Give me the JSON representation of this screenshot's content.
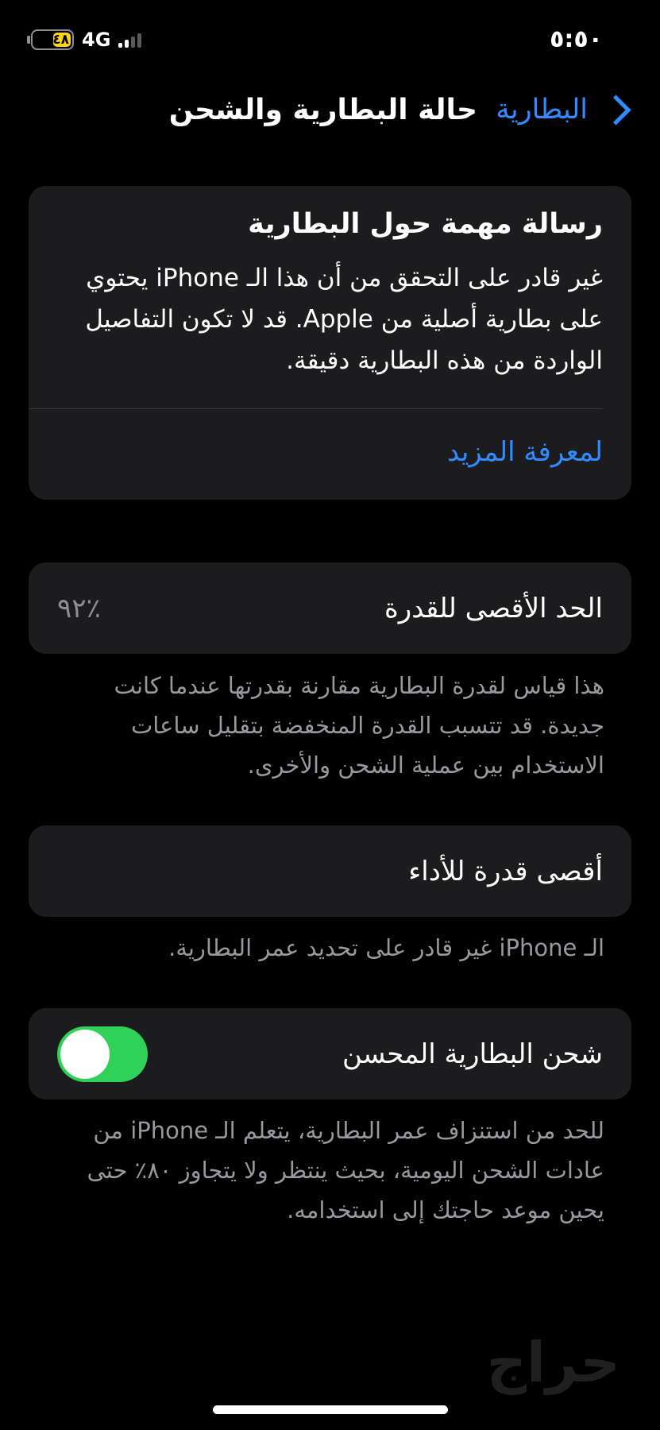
{
  "status_bar": {
    "time": "٥:٥٠",
    "battery_level": "٤٨",
    "battery_fraction": 0.48,
    "network": "4G",
    "signal_bars_active": 2,
    "signal_bars_total": 4
  },
  "nav": {
    "back_label": "البطارية",
    "title": "حالة البطارية والشحن"
  },
  "message": {
    "title": "رسالة مهمة حول البطارية",
    "body": "غير قادر على التحقق من أن هذا الـ iPhone يحتوي على بطارية أصلية من Apple. قد لا تكون التفاصيل الواردة من هذه البطارية دقيقة.",
    "learn_more": "لمعرفة المزيد"
  },
  "capacity": {
    "label": "الحد الأقصى للقدرة",
    "value": "٪٩٢",
    "note": "هذا قياس لقدرة البطارية مقارنة بقدرتها عندما كانت جديدة. قد تتسبب القدرة المنخفضة بتقليل ساعات الاستخدام بين عملية الشحن والأخرى."
  },
  "performance": {
    "label": "أقصى قدرة للأداء",
    "note": "الـ iPhone غير قادر على تحديد عمر البطارية."
  },
  "optimized_charging": {
    "label": "شحن البطارية المحسن",
    "enabled": true,
    "note": "للحد من استنزاف عمر البطارية، يتعلم الـ iPhone من عادات الشحن اليومية، بحيث ينتظر ولا يتجاوز ٨٠٪ حتى يحين موعد حاجتك إلى استخدامه."
  },
  "watermark": "حراج",
  "colors": {
    "accent": "#2f8bff",
    "toggle_on": "#30d158",
    "battery_low_power": "#ffd60a",
    "card_bg": "#1c1c1e"
  }
}
